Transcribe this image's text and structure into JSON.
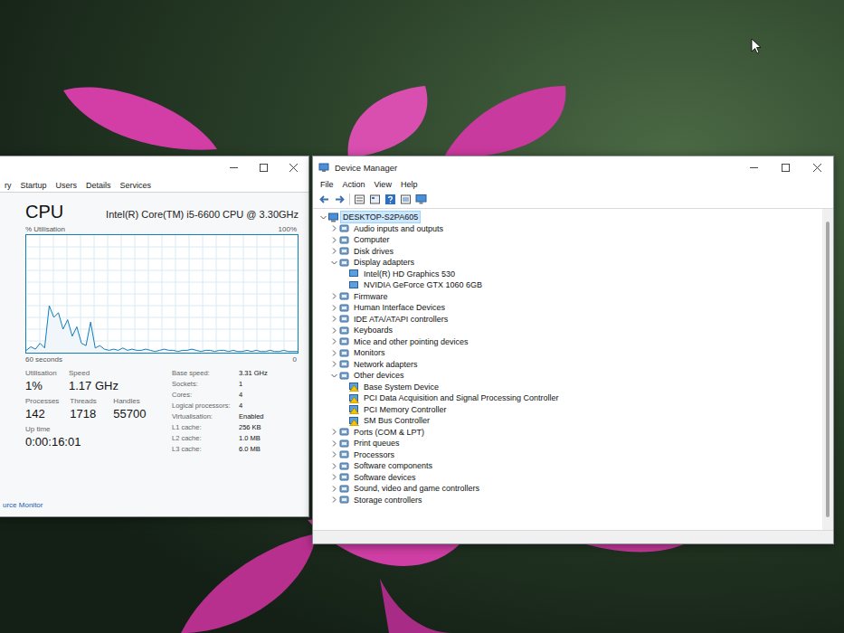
{
  "task_manager": {
    "tabs": [
      {
        "label": "ry",
        "selected": false
      },
      {
        "label": "Startup",
        "selected": false
      },
      {
        "label": "Users",
        "selected": false
      },
      {
        "label": "Details",
        "selected": false
      },
      {
        "label": "Services",
        "selected": false
      }
    ],
    "heading": "CPU",
    "model": "Intel(R) Core(TM) i5-6600 CPU @ 3.30GHz",
    "chart": {
      "y_label": "% Utilisation",
      "y_max": "100%",
      "x_label": "60 seconds",
      "y_min": "0",
      "series": [
        {
          "name": "CPU",
          "values": [
            2,
            5,
            3,
            8,
            4,
            40,
            30,
            34,
            20,
            28,
            14,
            22,
            8,
            6,
            26,
            4,
            6,
            3,
            2,
            3,
            2,
            4,
            2,
            3,
            2,
            2,
            3,
            2,
            1,
            2,
            3,
            2,
            2,
            1,
            2,
            2,
            3,
            2,
            1,
            2,
            2,
            1,
            2,
            2,
            1,
            2,
            1,
            1,
            2,
            1,
            2,
            1,
            1,
            2,
            1,
            1,
            2,
            1,
            1,
            1
          ]
        }
      ]
    },
    "stats": [
      [
        {
          "label": "Utilisation",
          "value": "1%"
        },
        {
          "label": "Speed",
          "value": "1.17 GHz"
        }
      ],
      [
        {
          "label": "Processes",
          "value": "142"
        },
        {
          "label": "Threads",
          "value": "1718"
        },
        {
          "label": "Handles",
          "value": "55700"
        }
      ],
      [
        {
          "label": "Up time",
          "value": "0:00:16:01"
        }
      ]
    ],
    "details": [
      {
        "label": "Base speed:",
        "value": "3.31 GHz"
      },
      {
        "label": "Sockets:",
        "value": "1"
      },
      {
        "label": "Cores:",
        "value": "4"
      },
      {
        "label": "Logical processors:",
        "value": "4"
      },
      {
        "label": "Virtualisation:",
        "value": "Enabled"
      },
      {
        "label": "L1 cache:",
        "value": "256 KB"
      },
      {
        "label": "L2 cache:",
        "value": "1.0 MB"
      },
      {
        "label": "L3 cache:",
        "value": "6.0 MB"
      }
    ],
    "footer_link": "urce Monitor"
  },
  "device_manager": {
    "title": "Device Manager",
    "menu": [
      "File",
      "Action",
      "View",
      "Help"
    ],
    "tree": [
      {
        "label": "DESKTOP-S2PA605",
        "kind": "root",
        "expanded": true,
        "selected": true
      },
      {
        "label": "Audio inputs and outputs",
        "kind": "category",
        "expanded": false,
        "selected": false
      },
      {
        "label": "Computer",
        "kind": "category",
        "expanded": false,
        "selected": false
      },
      {
        "label": "Disk drives",
        "kind": "category",
        "expanded": false,
        "selected": false
      },
      {
        "label": "Display adapters",
        "kind": "category",
        "expanded": true,
        "selected": false
      },
      {
        "label": "Intel(R) HD Graphics 530",
        "kind": "device",
        "problem": false,
        "selected": false
      },
      {
        "label": "NVIDIA GeForce GTX 1060 6GB",
        "kind": "device",
        "problem": false,
        "selected": false
      },
      {
        "label": "Firmware",
        "kind": "category",
        "expanded": false,
        "selected": false
      },
      {
        "label": "Human Interface Devices",
        "kind": "category",
        "expanded": false,
        "selected": false
      },
      {
        "label": "IDE ATA/ATAPI controllers",
        "kind": "category",
        "expanded": false,
        "selected": false
      },
      {
        "label": "Keyboards",
        "kind": "category",
        "expanded": false,
        "selected": false
      },
      {
        "label": "Mice and other pointing devices",
        "kind": "category",
        "expanded": false,
        "selected": false
      },
      {
        "label": "Monitors",
        "kind": "category",
        "expanded": false,
        "selected": false
      },
      {
        "label": "Network adapters",
        "kind": "category",
        "expanded": false,
        "selected": false
      },
      {
        "label": "Other devices",
        "kind": "category",
        "expanded": true,
        "selected": false
      },
      {
        "label": "Base System Device",
        "kind": "device",
        "problem": true,
        "selected": false
      },
      {
        "label": "PCI Data Acquisition and Signal Processing Controller",
        "kind": "device",
        "problem": true,
        "selected": false
      },
      {
        "label": "PCI Memory Controller",
        "kind": "device",
        "problem": true,
        "selected": false
      },
      {
        "label": "SM Bus Controller",
        "kind": "device",
        "problem": true,
        "selected": false
      },
      {
        "label": "Ports (COM & LPT)",
        "kind": "category",
        "expanded": false,
        "selected": false
      },
      {
        "label": "Print queues",
        "kind": "category",
        "expanded": false,
        "selected": false
      },
      {
        "label": "Processors",
        "kind": "category",
        "expanded": false,
        "selected": false
      },
      {
        "label": "Software components",
        "kind": "category",
        "expanded": false,
        "selected": false
      },
      {
        "label": "Software devices",
        "kind": "category",
        "expanded": false,
        "selected": false
      },
      {
        "label": "Sound, video and game controllers",
        "kind": "category",
        "expanded": false,
        "selected": false
      },
      {
        "label": "Storage controllers",
        "kind": "category",
        "expanded": false,
        "selected": false
      }
    ]
  }
}
